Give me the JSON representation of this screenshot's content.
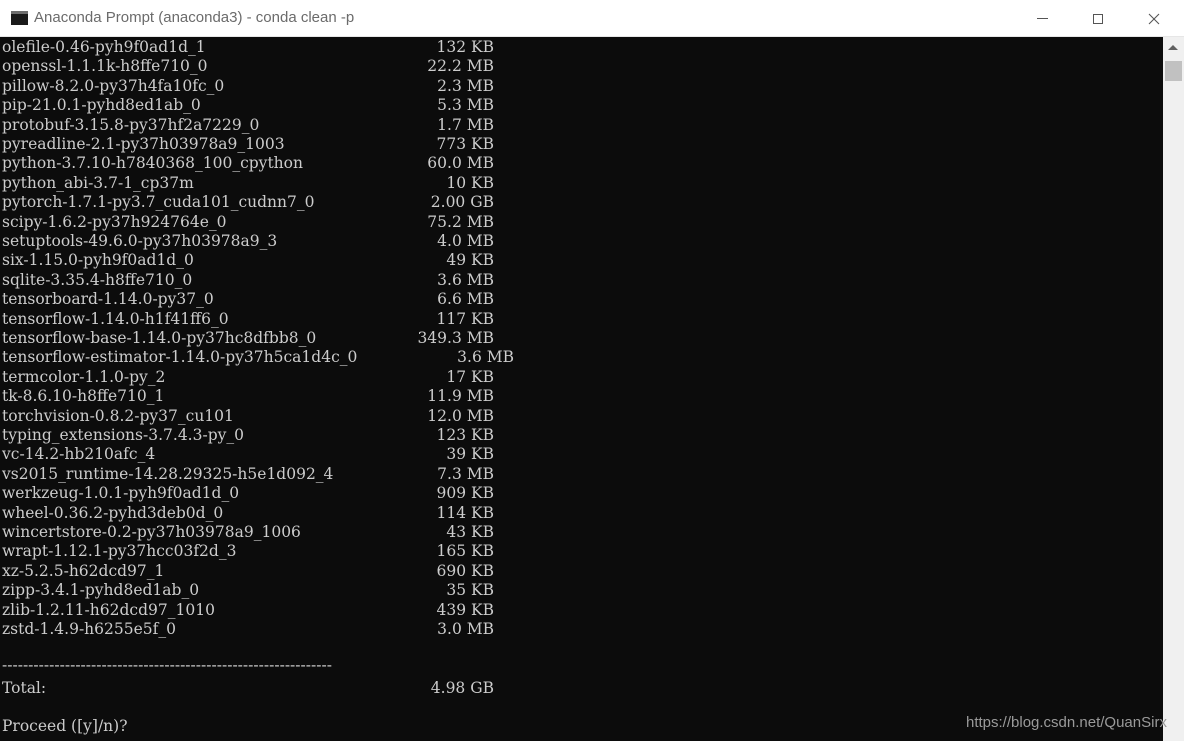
{
  "window": {
    "title": "Anaconda Prompt (anaconda3) - conda  clean -p"
  },
  "packages": [
    {
      "name": "olefile-0.46-pyh9f0ad1d_1",
      "size": "132 KB"
    },
    {
      "name": "openssl-1.1.1k-h8ffe710_0",
      "size": "22.2 MB"
    },
    {
      "name": "pillow-8.2.0-py37h4fa10fc_0",
      "size": "2.3 MB"
    },
    {
      "name": "pip-21.0.1-pyhd8ed1ab_0",
      "size": "5.3 MB"
    },
    {
      "name": "protobuf-3.15.8-py37hf2a7229_0",
      "size": "1.7 MB"
    },
    {
      "name": "pyreadline-2.1-py37h03978a9_1003",
      "size": "773 KB"
    },
    {
      "name": "python-3.7.10-h7840368_100_cpython",
      "size": "60.0 MB"
    },
    {
      "name": "python_abi-3.7-1_cp37m",
      "size": "10 KB"
    },
    {
      "name": "pytorch-1.7.1-py3.7_cuda101_cudnn7_0",
      "size": "2.00 GB"
    },
    {
      "name": "scipy-1.6.2-py37h924764e_0",
      "size": "75.2 MB"
    },
    {
      "name": "setuptools-49.6.0-py37h03978a9_3",
      "size": "4.0 MB"
    },
    {
      "name": "six-1.15.0-pyh9f0ad1d_0",
      "size": "49 KB"
    },
    {
      "name": "sqlite-3.35.4-h8ffe710_0",
      "size": "3.6 MB"
    },
    {
      "name": "tensorboard-1.14.0-py37_0",
      "size": "6.6 MB"
    },
    {
      "name": "tensorflow-1.14.0-h1f41ff6_0",
      "size": "117 KB"
    },
    {
      "name": "tensorflow-base-1.14.0-py37hc8dfbb8_0",
      "size": "349.3 MB"
    },
    {
      "name": "tensorflow-estimator-1.14.0-py37h5ca1d4c_0",
      "size": "3.6 MB"
    },
    {
      "name": "termcolor-1.1.0-py_2",
      "size": "17 KB"
    },
    {
      "name": "tk-8.6.10-h8ffe710_1",
      "size": "11.9 MB"
    },
    {
      "name": "torchvision-0.8.2-py37_cu101",
      "size": "12.0 MB"
    },
    {
      "name": "typing_extensions-3.7.4.3-py_0",
      "size": "123 KB"
    },
    {
      "name": "vc-14.2-hb210afc_4",
      "size": "39 KB"
    },
    {
      "name": "vs2015_runtime-14.28.29325-h5e1d092_4",
      "size": "7.3 MB"
    },
    {
      "name": "werkzeug-1.0.1-pyh9f0ad1d_0",
      "size": "909 KB"
    },
    {
      "name": "wheel-0.36.2-pyhd3deb0d_0",
      "size": "114 KB"
    },
    {
      "name": "wincertstore-0.2-py37h03978a9_1006",
      "size": "43 KB"
    },
    {
      "name": "wrapt-1.12.1-py37hcc03f2d_3",
      "size": "165 KB"
    },
    {
      "name": "xz-5.2.5-h62dcd97_1",
      "size": "690 KB"
    },
    {
      "name": "zipp-3.4.1-pyhd8ed1ab_0",
      "size": "35 KB"
    },
    {
      "name": "zlib-1.2.11-h62dcd97_1010",
      "size": "439 KB"
    },
    {
      "name": "zstd-1.4.9-h6255e5f_0",
      "size": "3.0 MB"
    }
  ],
  "separator": "---------------------------------------------------------------",
  "total": {
    "label": "Total:",
    "size": "4.98 GB"
  },
  "prompt": "Proceed ([y]/n)?",
  "watermark": "https://blog.csdn.net/QuanSirx",
  "icons": {
    "app": "console-icon",
    "minimize": "minimize-icon",
    "maximize": "maximize-icon",
    "close": "close-icon",
    "scroll_up": "chevron-up-icon"
  },
  "colors": {
    "console_bg": "#0c0c0c",
    "console_text": "#cccccc",
    "titlebar_bg": "#ffffff"
  }
}
